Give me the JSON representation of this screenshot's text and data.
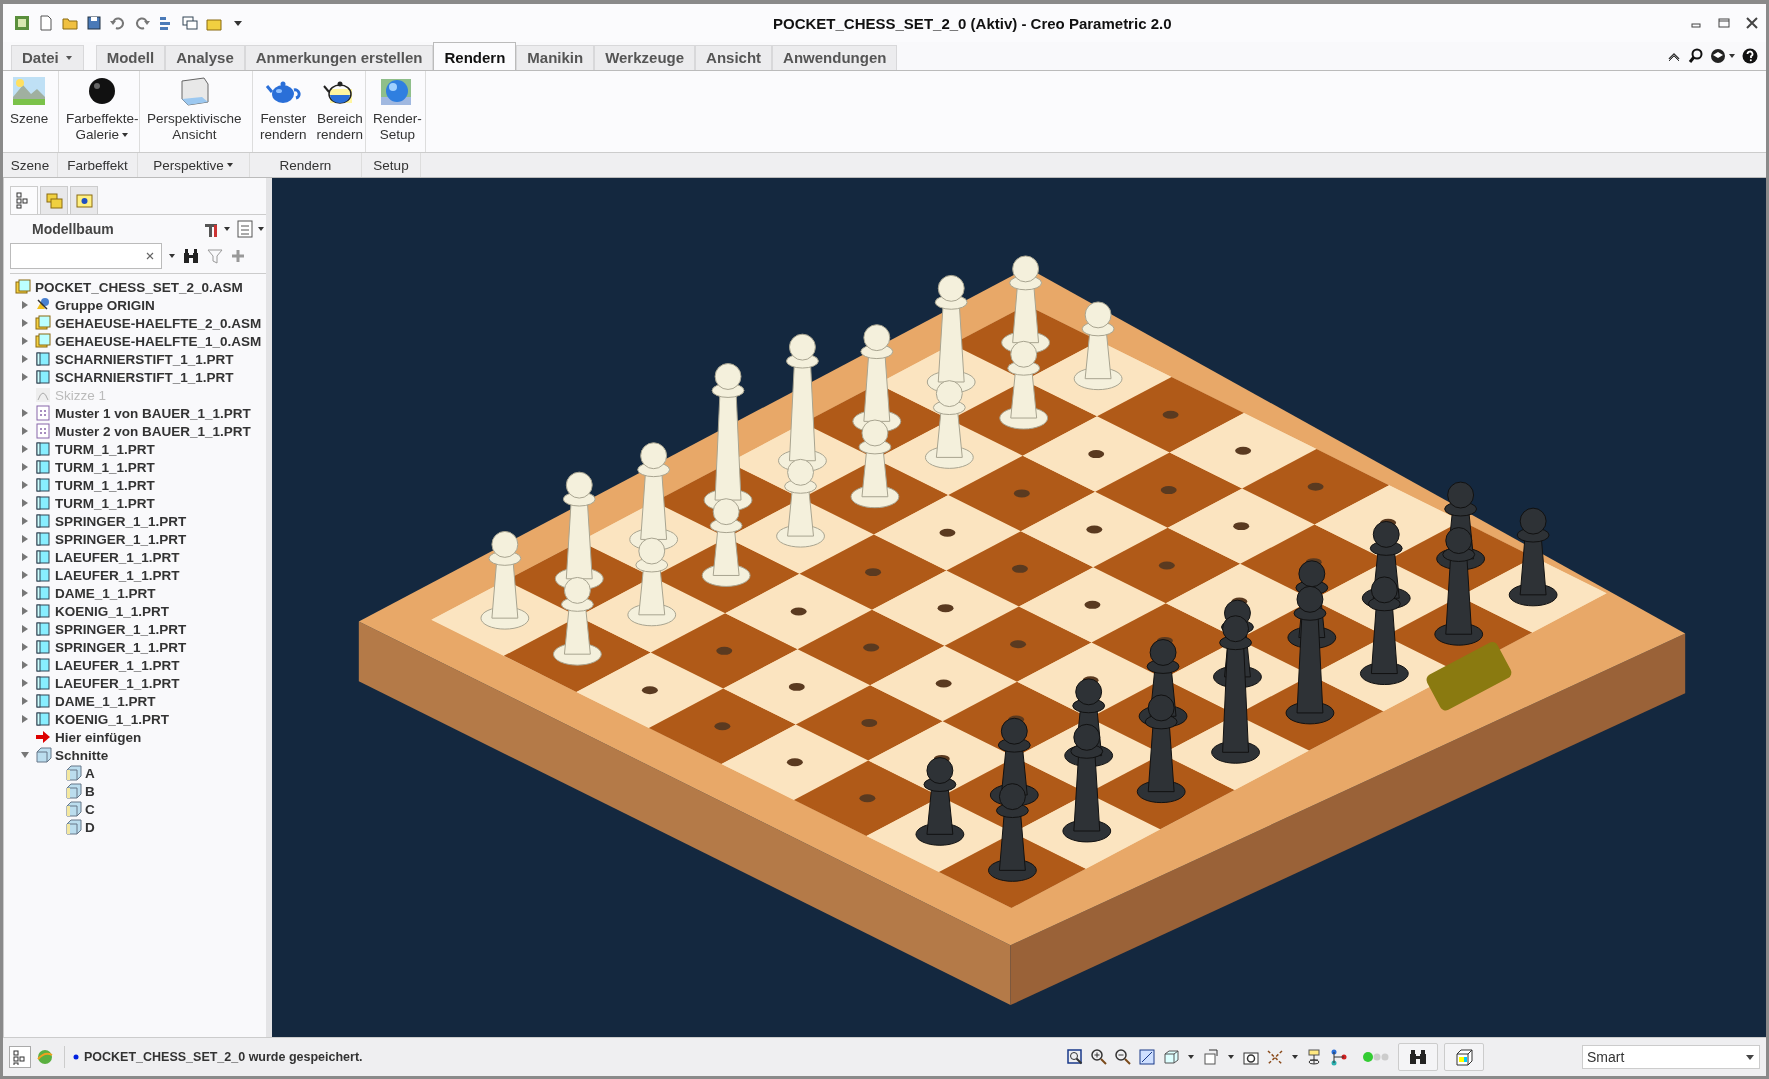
{
  "window": {
    "title": "POCKET_CHESS_SET_2_0 (Aktiv) - Creo Parametric 2.0"
  },
  "tabs": [
    {
      "label": "Datei",
      "kind": "menu",
      "selected": false
    },
    {
      "label": "Modell",
      "kind": "tab",
      "selected": false
    },
    {
      "label": "Analyse",
      "kind": "tab",
      "selected": false
    },
    {
      "label": "Anmerkungen erstellen",
      "kind": "tab",
      "selected": false
    },
    {
      "label": "Rendern",
      "kind": "tab",
      "selected": true
    },
    {
      "label": "Manikin",
      "kind": "tab",
      "selected": false
    },
    {
      "label": "Werkzeuge",
      "kind": "tab",
      "selected": false
    },
    {
      "label": "Ansicht",
      "kind": "tab",
      "selected": false
    },
    {
      "label": "Anwendungen",
      "kind": "tab",
      "selected": false
    }
  ],
  "ribbon": {
    "groups": [
      {
        "label": "Szene",
        "dropdown": false,
        "buttons": [
          {
            "label": "Szene",
            "dropdown": false
          }
        ]
      },
      {
        "label": "Farbeffekt",
        "dropdown": false,
        "buttons": [
          {
            "label": "Farbeffekte-\nGalerie",
            "dropdown": true
          }
        ]
      },
      {
        "label": "Perspektive",
        "dropdown": true,
        "buttons": [
          {
            "label": "Perspektivische\nAnsicht",
            "dropdown": false
          }
        ]
      },
      {
        "label": "Rendern",
        "dropdown": false,
        "buttons": [
          {
            "label": "Fenster\nrendern",
            "dropdown": false
          },
          {
            "label": "Bereich\nrendern",
            "dropdown": false
          }
        ]
      },
      {
        "label": "Setup",
        "dropdown": false,
        "buttons": [
          {
            "label": "Render-\nSetup",
            "dropdown": false
          }
        ]
      }
    ]
  },
  "panel_tabs": [
    {
      "selected": true
    },
    {
      "selected": false
    },
    {
      "selected": false
    }
  ],
  "view_toggles": [
    {
      "selected": true
    },
    {
      "selected": false
    }
  ],
  "model_tree": {
    "title": "Modellbaum",
    "items": [
      {
        "label": "POCKET_CHESS_SET_2_0.ASM",
        "kind": "asm",
        "disabled": false,
        "children": [
          {
            "label": "Gruppe ORIGIN",
            "kind": "group",
            "expanded": false,
            "disabled": false
          },
          {
            "label": "GEHAEUSE-HAELFTE_2_0.ASM",
            "kind": "asm",
            "expanded": false,
            "disabled": false
          },
          {
            "label": "GEHAEUSE-HAELFTE_1_0.ASM",
            "kind": "asm",
            "expanded": false,
            "disabled": false
          },
          {
            "label": "SCHARNIERSTIFT_1_1.PRT",
            "kind": "part",
            "expanded": false,
            "disabled": false
          },
          {
            "label": "SCHARNIERSTIFT_1_1.PRT",
            "kind": "part",
            "expanded": false,
            "disabled": false
          },
          {
            "label": "Skizze 1",
            "kind": "sketch",
            "disabled": true
          },
          {
            "label": "Muster 1 von BAUER_1_1.PRT",
            "kind": "pattern",
            "expanded": false,
            "disabled": false
          },
          {
            "label": "Muster 2 von BAUER_1_1.PRT",
            "kind": "pattern",
            "expanded": false,
            "disabled": false
          },
          {
            "label": "TURM_1_1.PRT",
            "kind": "part",
            "expanded": false,
            "disabled": false
          },
          {
            "label": "TURM_1_1.PRT",
            "kind": "part",
            "expanded": false,
            "disabled": false
          },
          {
            "label": "TURM_1_1.PRT",
            "kind": "part",
            "expanded": false,
            "disabled": false
          },
          {
            "label": "TURM_1_1.PRT",
            "kind": "part",
            "expanded": false,
            "disabled": false
          },
          {
            "label": "SPRINGER_1_1.PRT",
            "kind": "part",
            "expanded": false,
            "disabled": false
          },
          {
            "label": "SPRINGER_1_1.PRT",
            "kind": "part",
            "expanded": false,
            "disabled": false
          },
          {
            "label": "LAEUFER_1_1.PRT",
            "kind": "part",
            "expanded": false,
            "disabled": false
          },
          {
            "label": "LAEUFER_1_1.PRT",
            "kind": "part",
            "expanded": false,
            "disabled": false
          },
          {
            "label": "DAME_1_1.PRT",
            "kind": "part",
            "expanded": false,
            "disabled": false
          },
          {
            "label": "KOENIG_1_1.PRT",
            "kind": "part",
            "expanded": false,
            "disabled": false
          },
          {
            "label": "SPRINGER_1_1.PRT",
            "kind": "part",
            "expanded": false,
            "disabled": false
          },
          {
            "label": "SPRINGER_1_1.PRT",
            "kind": "part",
            "expanded": false,
            "disabled": false
          },
          {
            "label": "LAEUFER_1_1.PRT",
            "kind": "part",
            "expanded": false,
            "disabled": false
          },
          {
            "label": "LAEUFER_1_1.PRT",
            "kind": "part",
            "expanded": false,
            "disabled": false
          },
          {
            "label": "DAME_1_1.PRT",
            "kind": "part",
            "expanded": false,
            "disabled": false
          },
          {
            "label": "KOENIG_1_1.PRT",
            "kind": "part",
            "expanded": false,
            "disabled": false
          },
          {
            "label": "Hier einfügen",
            "kind": "insert",
            "disabled": false
          },
          {
            "label": "Schnitte",
            "kind": "folder",
            "expanded": true,
            "disabled": false,
            "children": [
              {
                "label": "A",
                "kind": "section",
                "disabled": false
              },
              {
                "label": "B",
                "kind": "section",
                "disabled": false
              },
              {
                "label": "C",
                "kind": "section",
                "disabled": false
              },
              {
                "label": "D",
                "kind": "section",
                "disabled": false
              }
            ]
          }
        ]
      }
    ]
  },
  "status_bar": {
    "message": "POCKET_CHESS_SET_2_0 wurde gespeichert.",
    "filter": "Smart"
  }
}
